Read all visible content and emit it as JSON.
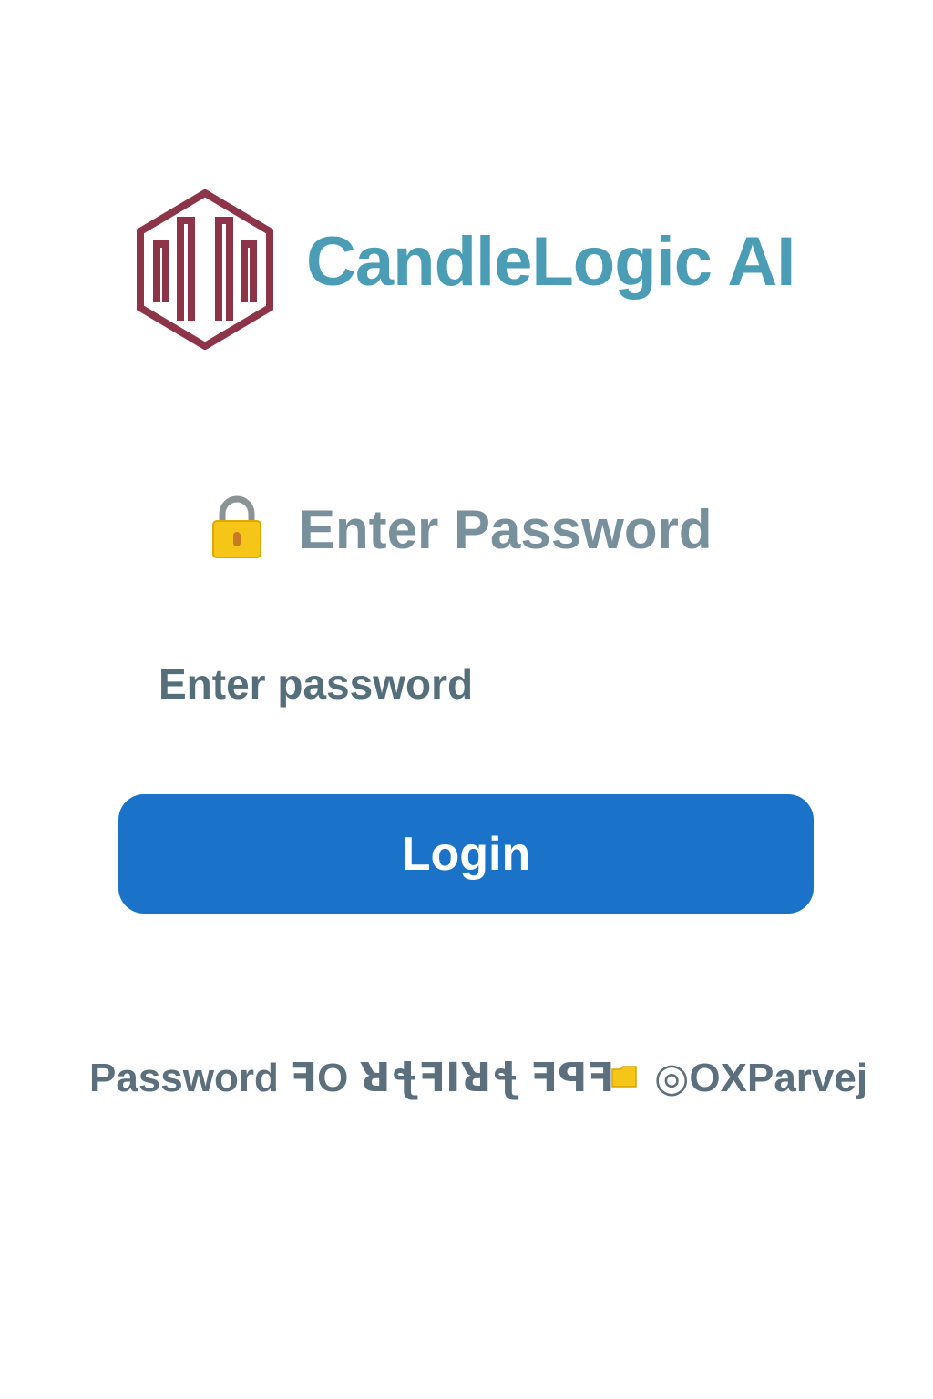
{
  "brand": {
    "name": "CandleLogic AI",
    "logo_icon": "candle-chart-hexagon-logo",
    "name_color": "#4a9db5",
    "logo_color": "#8e3448"
  },
  "login_form": {
    "heading": "Enter Password",
    "heading_icon": "lock-icon",
    "heading_color": "#78909c",
    "password_placeholder": "Enter password",
    "password_value": "",
    "login_label": "Login",
    "button_color": "#1a73c8"
  },
  "footer": {
    "text": "Password ꟻO ꓤꞎꟻꓲꓤꞎ ꟻꟼꟻ",
    "folder_icon": "folder-icon",
    "handle": "◎OXParvej",
    "text_color": "#5b6f7c"
  }
}
